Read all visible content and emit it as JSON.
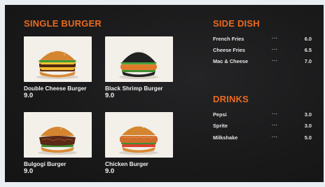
{
  "single_burger": {
    "heading": "SINGLE BURGER",
    "items": [
      {
        "name": "Double Cheese Burger",
        "price": "9.0"
      },
      {
        "name": "Black Shrimp Burger",
        "price": "9.0"
      },
      {
        "name": "Bulgogi Burger",
        "price": "9.0"
      },
      {
        "name": "Chicken Burger",
        "price": "9.0"
      }
    ]
  },
  "side_dish": {
    "heading": "SIDE DISH",
    "items": [
      {
        "name": "French Fries",
        "dots": "···",
        "price": "6.0"
      },
      {
        "name": "Cheese Fries",
        "dots": "···",
        "price": "6.5"
      },
      {
        "name": "Mac & Cheese",
        "dots": "···",
        "price": "7.0"
      }
    ]
  },
  "drinks": {
    "heading": "DRINKS",
    "items": [
      {
        "name": "Pepsi",
        "dots": "···",
        "price": "3.0"
      },
      {
        "name": "Sprite",
        "dots": "···",
        "price": "3.0"
      },
      {
        "name": "Milkshake",
        "dots": "···",
        "price": "5.0"
      }
    ]
  },
  "colors": {
    "accent": "#ea6a1f",
    "background": "#1b1b1c",
    "text": "#f2f2f2"
  }
}
